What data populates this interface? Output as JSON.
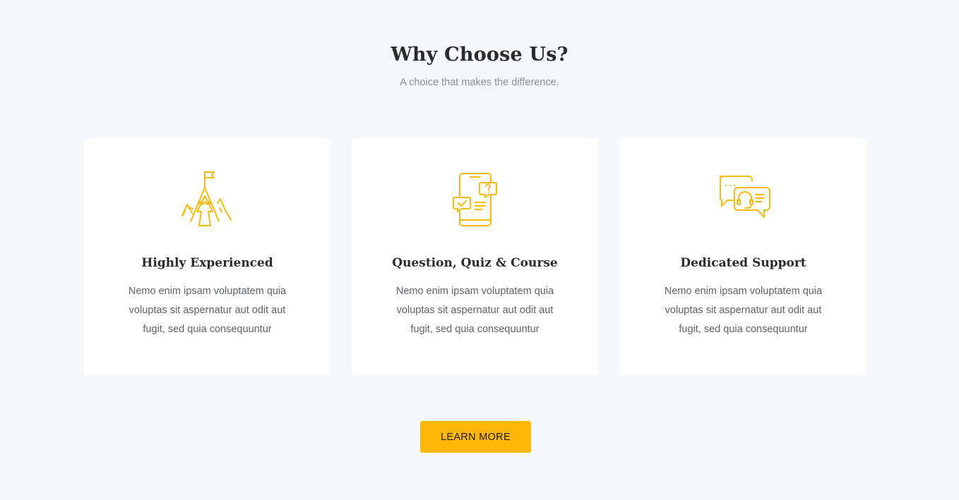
{
  "header": {
    "title": "Why Choose Us?",
    "subtitle": "A choice that makes the difference."
  },
  "theme": {
    "accent": "#ffb606",
    "background": "#f4f8fc",
    "card_background": "#ffffff",
    "icon_color": "#f7b90f"
  },
  "cards": [
    {
      "icon": "mountain-flag-icon",
      "title": "Highly Experienced",
      "text": "Nemo enim ipsam voluptatem quia voluptas sit aspernatur aut odit aut fugit, sed quia consequuntur"
    },
    {
      "icon": "phone-quiz-icon",
      "title": "Question, Quiz & Course",
      "text": "Nemo enim ipsam voluptatem quia voluptas sit aspernatur aut odit aut fugit, sed quia consequuntur"
    },
    {
      "icon": "support-chat-icon",
      "title": "Dedicated Support",
      "text": "Nemo enim ipsam voluptatem quia voluptas sit aspernatur aut odit aut fugit, sed quia consequuntur"
    }
  ],
  "cta": {
    "label": "LEARN MORE"
  }
}
